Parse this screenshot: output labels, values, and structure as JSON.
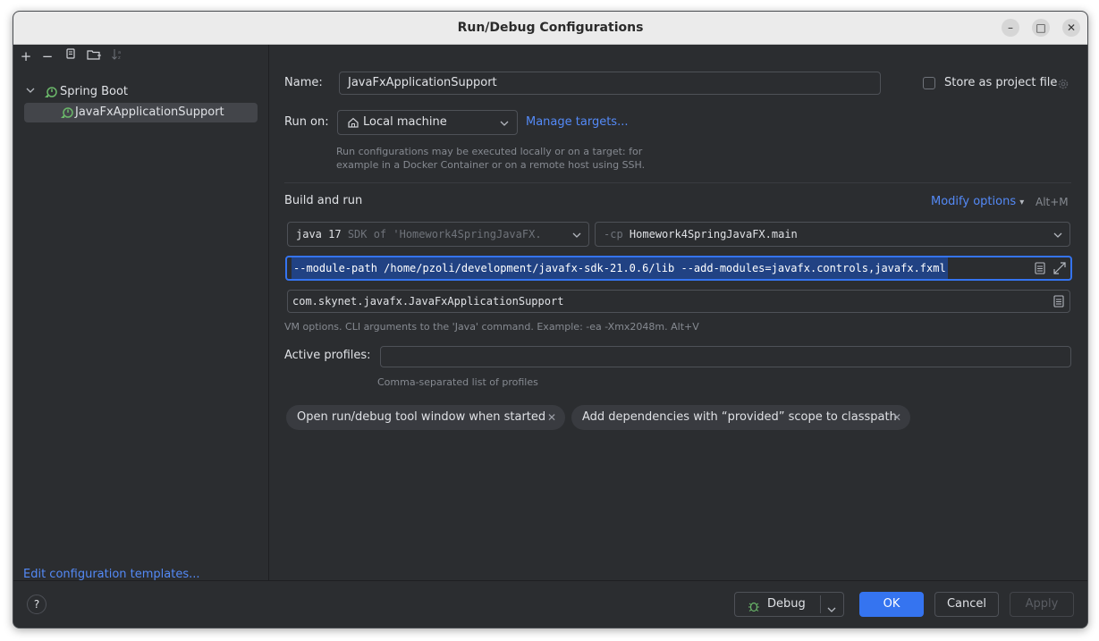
{
  "window": {
    "title": "Run/Debug Configurations",
    "controls": {
      "minimize": "–",
      "maximize": "□",
      "close": "✕"
    }
  },
  "sidebar": {
    "toolbar_icons": [
      "add-icon",
      "remove-icon",
      "copy-icon",
      "new-folder-icon",
      "sort-icon"
    ],
    "tree": {
      "group_label": "Spring Boot",
      "items": [
        {
          "label": "JavaFxApplicationSupport",
          "selected": true
        }
      ]
    },
    "edit_templates_link": "Edit configuration templates..."
  },
  "form": {
    "name_label": "Name:",
    "name_value": "JavaFxApplicationSupport",
    "store_label": "Store as project file",
    "run_on_label": "Run on:",
    "run_on_value": "Local machine",
    "manage_targets": "Manage targets...",
    "run_on_hint_1": "Run configurations may be executed locally or on a target: for",
    "run_on_hint_2": "example in a Docker Container or on a remote host using SSH.",
    "section_title": "Build and run",
    "modify_options": "Modify options",
    "modify_shortcut": "Alt+M",
    "jdk_value": "java 17",
    "jdk_suffix": "SDK of 'Homework4SpringJavaFX.",
    "cp_prefix": "-cp",
    "cp_value": "Homework4SpringJavaFX.main",
    "vm_options": "--module-path /home/pzoli/development/javafx-sdk-21.0.6/lib --add-modules=javafx.controls,javafx.fxml",
    "main_class": "com.skynet.javafx.JavaFxApplicationSupport",
    "vm_hint": "VM options. CLI arguments to the 'Java' command. Example: -ea -Xmx2048m. Alt+V",
    "profiles_label": "Active profiles:",
    "profiles_value": "",
    "profiles_hint": "Comma-separated list of profiles",
    "chips": [
      "Open run/debug tool window when started",
      "Add dependencies with “provided” scope to classpath"
    ]
  },
  "footer": {
    "help": "?",
    "debug": "Debug",
    "ok": "OK",
    "cancel": "Cancel",
    "apply": "Apply"
  },
  "colors": {
    "background": "#2b2d30",
    "accent": "#3574f0",
    "link": "#548af7",
    "selection": "#214283",
    "spring_green": "#6bb86a"
  }
}
